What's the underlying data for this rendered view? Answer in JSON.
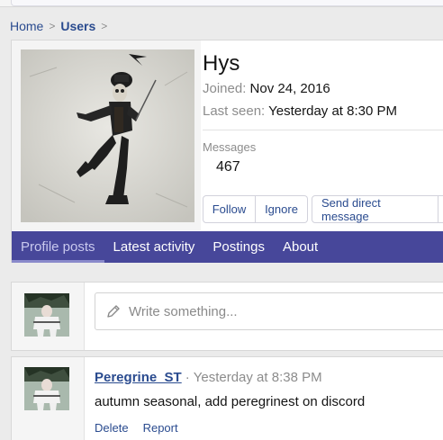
{
  "breadcrumb": {
    "items": [
      {
        "label": "Home"
      },
      {
        "label": "Users"
      }
    ],
    "separator": ">"
  },
  "profile": {
    "username": "Hys",
    "joined_label": "Joined:",
    "joined_value": "Nov 24, 2016",
    "last_seen_label": "Last seen:",
    "last_seen_value": "Yesterday at 8:30 PM",
    "messages_label": "Messages",
    "messages_value": "467",
    "buttons": {
      "follow": "Follow",
      "ignore": "Ignore",
      "send_dm": "Send direct message"
    }
  },
  "tabs": [
    {
      "label": "Profile posts",
      "active": true
    },
    {
      "label": "Latest activity",
      "active": false
    },
    {
      "label": "Postings",
      "active": false
    },
    {
      "label": "About",
      "active": false
    }
  ],
  "composer": {
    "placeholder": "Write something..."
  },
  "post": {
    "author": "Peregrine_ST",
    "separator": "·",
    "time": "Yesterday at 8:38 PM",
    "body": "autumn seasonal, add peregrinest on discord",
    "actions": {
      "delete": "Delete",
      "report": "Report"
    }
  },
  "colors": {
    "link": "#2a4b8f",
    "tab_bar": "#47479a",
    "muted": "#8c8c8c"
  }
}
